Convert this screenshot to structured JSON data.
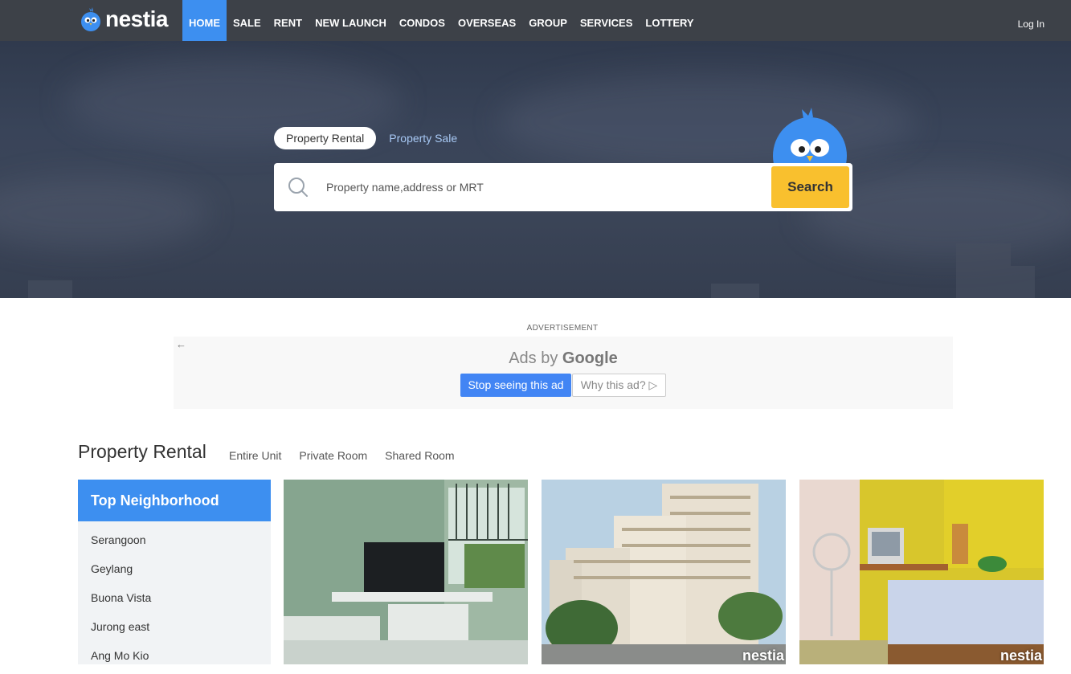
{
  "brand": {
    "name": "nestia",
    "accent": "#3d8ff0"
  },
  "nav": {
    "items": [
      {
        "label": "HOME",
        "active": true
      },
      {
        "label": "SALE"
      },
      {
        "label": "RENT"
      },
      {
        "label": "NEW LAUNCH"
      },
      {
        "label": "CONDOS"
      },
      {
        "label": "OVERSEAS"
      },
      {
        "label": "GROUP"
      },
      {
        "label": "SERVICES"
      },
      {
        "label": "LOTTERY"
      }
    ],
    "login": "Log In"
  },
  "hero": {
    "tabs": [
      {
        "label": "Property Rental",
        "active": true
      },
      {
        "label": "Property Sale"
      }
    ],
    "search": {
      "placeholder": "Property name,address or MRT",
      "value": "",
      "button": "Search"
    }
  },
  "ad": {
    "label": "ADVERTISEMENT",
    "title_prefix": "Ads by",
    "title_brand": "Google",
    "stop": "Stop seeing this ad",
    "why": "Why this ad? ▷"
  },
  "listing": {
    "title": "Property Rental",
    "subtabs": [
      "Entire Unit",
      "Private Room",
      "Shared Room"
    ],
    "sidebar": {
      "heading": "Top Neighborhood",
      "items": [
        "Serangoon",
        "Geylang",
        "Buona Vista",
        "Jurong east",
        "Ang Mo Kio"
      ]
    },
    "cards": [
      {
        "watermark": ""
      },
      {
        "watermark": "nestia"
      },
      {
        "watermark": "nestia"
      }
    ]
  }
}
